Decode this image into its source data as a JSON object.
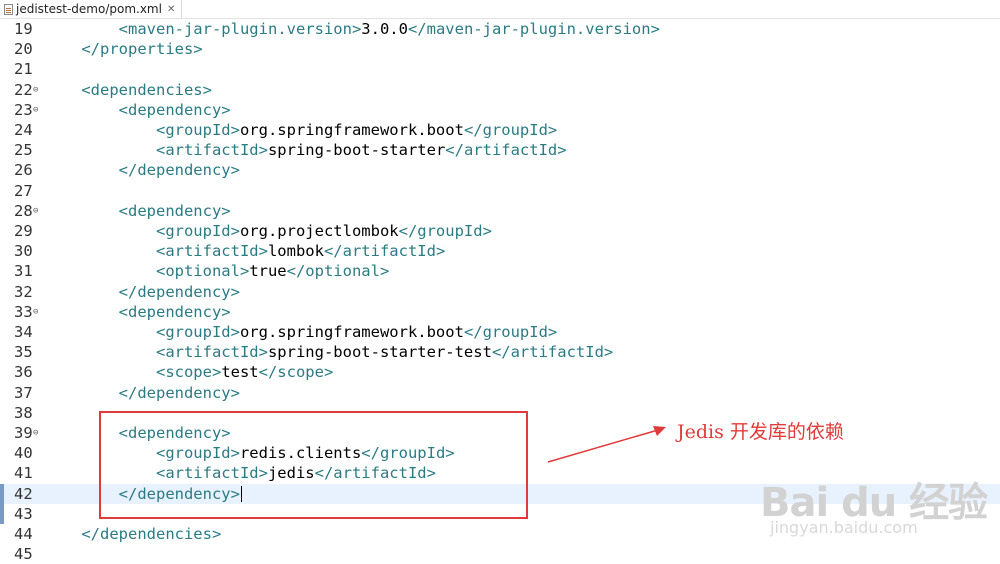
{
  "tab": {
    "title": "jedistest-demo/pom.xml",
    "close_glyph": "✕"
  },
  "editor": {
    "current_line": 42,
    "lines": [
      {
        "n": "19",
        "fold": false,
        "parts": [
          [
            "tag",
            "        <maven-jar-plugin.version>"
          ],
          [
            "txt",
            "3.0.0"
          ],
          [
            "tag",
            "</maven-jar-plugin.version>"
          ]
        ]
      },
      {
        "n": "20",
        "fold": false,
        "parts": [
          [
            "tag",
            "    </properties>"
          ]
        ]
      },
      {
        "n": "21",
        "fold": false,
        "parts": []
      },
      {
        "n": "22",
        "fold": true,
        "parts": [
          [
            "tag",
            "    <dependencies>"
          ]
        ]
      },
      {
        "n": "23",
        "fold": true,
        "parts": [
          [
            "tag",
            "        <dependency>"
          ]
        ]
      },
      {
        "n": "24",
        "fold": false,
        "parts": [
          [
            "tag",
            "            <groupId>"
          ],
          [
            "txt",
            "org.springframework.boot"
          ],
          [
            "tag",
            "</groupId>"
          ]
        ]
      },
      {
        "n": "25",
        "fold": false,
        "parts": [
          [
            "tag",
            "            <artifactId>"
          ],
          [
            "txt",
            "spring-boot-starter"
          ],
          [
            "tag",
            "</artifactId>"
          ]
        ]
      },
      {
        "n": "26",
        "fold": false,
        "parts": [
          [
            "tag",
            "        </dependency>"
          ]
        ]
      },
      {
        "n": "27",
        "fold": false,
        "parts": []
      },
      {
        "n": "28",
        "fold": true,
        "parts": [
          [
            "tag",
            "        <dependency>"
          ]
        ]
      },
      {
        "n": "29",
        "fold": false,
        "parts": [
          [
            "tag",
            "            <groupId>"
          ],
          [
            "txt",
            "org.projectlombok"
          ],
          [
            "tag",
            "</groupId>"
          ]
        ]
      },
      {
        "n": "30",
        "fold": false,
        "parts": [
          [
            "tag",
            "            <artifactId>"
          ],
          [
            "txt",
            "lombok"
          ],
          [
            "tag",
            "</artifactId>"
          ]
        ]
      },
      {
        "n": "31",
        "fold": false,
        "parts": [
          [
            "tag",
            "            <optional>"
          ],
          [
            "txt",
            "true"
          ],
          [
            "tag",
            "</optional>"
          ]
        ]
      },
      {
        "n": "32",
        "fold": false,
        "parts": [
          [
            "tag",
            "        </dependency>"
          ]
        ]
      },
      {
        "n": "33",
        "fold": true,
        "parts": [
          [
            "tag",
            "        <dependency>"
          ]
        ]
      },
      {
        "n": "34",
        "fold": false,
        "parts": [
          [
            "tag",
            "            <groupId>"
          ],
          [
            "txt",
            "org.springframework.boot"
          ],
          [
            "tag",
            "</groupId>"
          ]
        ]
      },
      {
        "n": "35",
        "fold": false,
        "parts": [
          [
            "tag",
            "            <artifactId>"
          ],
          [
            "txt",
            "spring-boot-starter-test"
          ],
          [
            "tag",
            "</artifactId>"
          ]
        ]
      },
      {
        "n": "36",
        "fold": false,
        "parts": [
          [
            "tag",
            "            <scope>"
          ],
          [
            "txt",
            "test"
          ],
          [
            "tag",
            "</scope>"
          ]
        ]
      },
      {
        "n": "37",
        "fold": false,
        "parts": [
          [
            "tag",
            "        </dependency>"
          ]
        ]
      },
      {
        "n": "38",
        "fold": false,
        "parts": []
      },
      {
        "n": "39",
        "fold": true,
        "parts": [
          [
            "tag",
            "        <dependency>"
          ]
        ]
      },
      {
        "n": "40",
        "fold": false,
        "parts": [
          [
            "tag",
            "            <groupId>"
          ],
          [
            "txt",
            "redis.clients"
          ],
          [
            "tag",
            "</groupId>"
          ]
        ]
      },
      {
        "n": "41",
        "fold": false,
        "parts": [
          [
            "tag",
            "            <artifactId>"
          ],
          [
            "txt",
            "jedis"
          ],
          [
            "tag",
            "</artifactId>"
          ]
        ]
      },
      {
        "n": "42",
        "fold": false,
        "parts": [
          [
            "tag",
            "        </dependency>"
          ]
        ],
        "caret": true
      },
      {
        "n": "43",
        "fold": false,
        "parts": []
      },
      {
        "n": "44",
        "fold": false,
        "parts": [
          [
            "tag",
            "    </dependencies>"
          ]
        ]
      },
      {
        "n": "45",
        "fold": false,
        "parts": []
      }
    ]
  },
  "annotation": {
    "text": "Jedis 开发库的依赖"
  },
  "watermark": {
    "brand": "Bai du 经验",
    "url": "jingyan.baidu.com"
  },
  "colors": {
    "tag": "#2b7b84",
    "text": "#000000",
    "annotation": "#e03a3a",
    "current_line": "#e8f2fe"
  }
}
